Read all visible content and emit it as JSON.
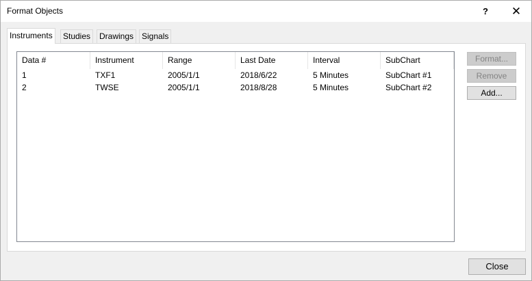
{
  "window": {
    "title": "Format Objects",
    "help_label": "?",
    "close_label": "✕"
  },
  "tabs": [
    {
      "label": "Instruments",
      "active": true
    },
    {
      "label": "Studies",
      "active": false
    },
    {
      "label": "Drawings",
      "active": false
    },
    {
      "label": "Signals",
      "active": false
    }
  ],
  "table": {
    "columns": [
      "Data #",
      "Instrument",
      "Range",
      "Last Date",
      "Interval",
      "SubChart"
    ],
    "rows": [
      [
        "1",
        "TXF1",
        "2005/1/1",
        "2018/6/22",
        "5 Minutes",
        "SubChart #1"
      ],
      [
        "2",
        "TWSE",
        "2005/1/1",
        "2018/8/28",
        "5 Minutes",
        "SubChart #2"
      ]
    ]
  },
  "buttons": {
    "format_label": "Format...",
    "remove_label": "Remove",
    "add_label": "Add...",
    "close_label": "Close"
  }
}
